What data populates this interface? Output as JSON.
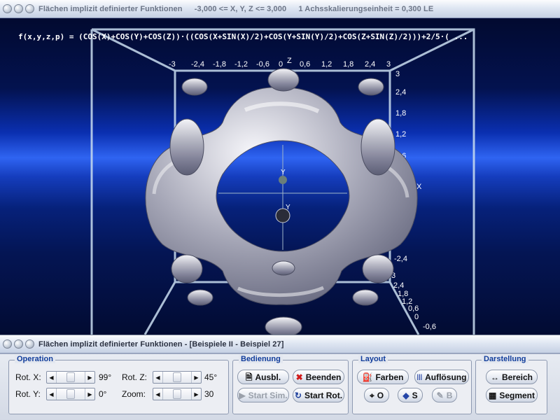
{
  "top_window": {
    "title_parts": [
      "Flächen implizit definierter Funktionen",
      "-3,000 <= X, Y, Z <= 3,000",
      "1 Achsskalierungseinheit = 0,300 LE"
    ],
    "formula": "f(x,y,z,p) = (COS(X)+COS(Y)+COS(Z))·((COS(X+SIN(X)/2)+COS(Y+SIN(Y)/2)+COS(Z+SIN(Z)/2)))+2/5·( ...",
    "x_ticks": [
      "-3",
      "-2,4",
      "-1,8",
      "-1,2",
      "-0,6",
      "0",
      "0,6",
      "1,2",
      "1,8",
      "2,4",
      "3"
    ],
    "z_ticks": [
      "3",
      "2,4",
      "1,8",
      "1,2",
      "0,6"
    ],
    "lower_ticks": [
      "3",
      "2,4",
      "1,8",
      "1,2",
      "0,6",
      "0",
      "-0,6"
    ],
    "left_ticks": [
      "-2,4"
    ],
    "axis_labels": {
      "x": "X",
      "y": "Y",
      "z": "Z"
    }
  },
  "bottom_window": {
    "title": "Flächen implizit definierter Funktionen - [Beispiele II - Beispiel 27]",
    "groups": {
      "operation": {
        "title": "Operation",
        "rot_x_label": "Rot. X:",
        "rot_x_value": "99°",
        "rot_y_label": "Rot. Y:",
        "rot_y_value": "0°",
        "rot_z_label": "Rot. Z:",
        "rot_z_value": "45°",
        "zoom_label": "Zoom:",
        "zoom_value": "30"
      },
      "bedienung": {
        "title": "Bedienung",
        "ausbl": "Ausbl.",
        "beenden": "Beenden",
        "start_sim": "Start Sim.",
        "start_rot": "Start Rot."
      },
      "layout": {
        "title": "Layout",
        "farben": "Farben",
        "aufloesung": "Auflösung",
        "o": "O",
        "s": "S",
        "b": "B"
      },
      "darstellung": {
        "title": "Darstellung",
        "bereich": "Bereich",
        "segment": "Segment"
      }
    }
  }
}
